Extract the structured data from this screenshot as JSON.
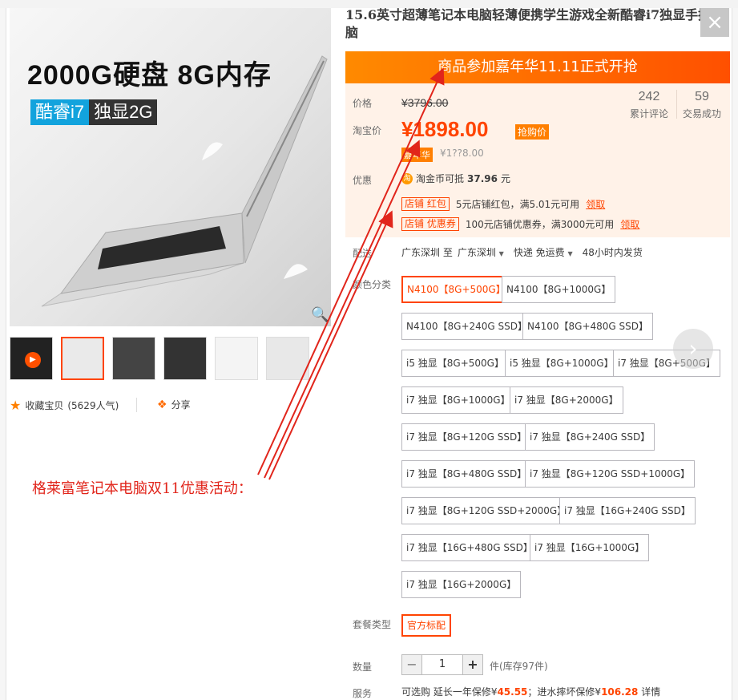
{
  "product": {
    "title": "15.6英寸超薄笔记本电脑轻薄便携学生游戏全新酷睿i7独显手提电脑",
    "promo_banner": "商品参加嘉年华11.11正式开抢"
  },
  "hero": {
    "headline": "2000G硬盘 8G内存",
    "badge_left": "酷睿i7",
    "badge_right": "独显2G"
  },
  "gallery": {
    "fav_label": "收藏宝贝",
    "fav_count": "(5629人气)",
    "share_label": "分享"
  },
  "pricing": {
    "price_label": "价格",
    "original_price": "¥3796.00",
    "taobao_label": "淘宝价",
    "taobao_price": "¥1898.00",
    "rush_badge": "抢购价",
    "carnival_badge": "嘉年华",
    "carnival_price": "¥1??8.00",
    "reviews_count": "242",
    "reviews_label": "累计评论",
    "sales_count": "59",
    "sales_label": "交易成功"
  },
  "discounts": {
    "label": "优惠",
    "coin_text": "淘金币可抵",
    "coin_amount": "37.96",
    "coin_unit": "元",
    "coupon1_tag": "店铺 红包",
    "coupon1_text": "5元店铺红包，满5.01元可用",
    "coupon1_action": "领取",
    "coupon2_tag": "店铺 优惠券",
    "coupon2_text": "100元店铺优惠券，满3000元可用",
    "coupon2_action": "领取"
  },
  "shipping": {
    "label": "配送",
    "from": "广东深圳 至",
    "to": "广东深圳",
    "method": "快递 免运费",
    "time": "48小时内发货"
  },
  "color": {
    "label": "颜色分类",
    "options": [
      "N4100【8G+500G】",
      "N4100【8G+1000G】",
      "N4100【8G+240G SSD】",
      "N4100【8G+480G SSD】",
      "i5 独显【8G+500G】",
      "i5 独显【8G+1000G】",
      "i7 独显【8G+500G】",
      "i7 独显【8G+1000G】",
      "i7 独显【8G+2000G】",
      "i7 独显【8G+120G SSD】",
      "i7 独显【8G+240G SSD】",
      "i7 独显【8G+480G SSD】",
      "i7 独显【8G+120G SSD+1000G】",
      "i7 独显【8G+120G SSD+2000G】",
      "i7 独显【16G+240G SSD】",
      "i7 独显【16G+480G SSD】",
      "i7 独显【16G+1000G】",
      "i7 独显【16G+2000G】"
    ]
  },
  "package": {
    "label": "套餐类型",
    "option": "官方标配"
  },
  "quantity": {
    "label": "数量",
    "minus": "−",
    "value": "1",
    "plus": "+",
    "stock": "件(库存97件)"
  },
  "service": {
    "label": "服务",
    "text1": "可选购 延长一年保修¥",
    "amount1": "45.55",
    "text2": "；进水摔坏保修¥",
    "amount2": "106.28",
    "text3": " 详情"
  },
  "annotation": {
    "text": "格莱富笔记本电脑双11优惠活动："
  },
  "colors": {
    "accent": "#ff4400",
    "banner": "#ff5000",
    "price_bg": "#fff2e8",
    "annotation": "#e1251b"
  },
  "icons": [
    "close-icon",
    "zoom-icon",
    "play-icon",
    "star-icon",
    "share-icon",
    "coin-icon",
    "chevron-right-icon"
  ]
}
